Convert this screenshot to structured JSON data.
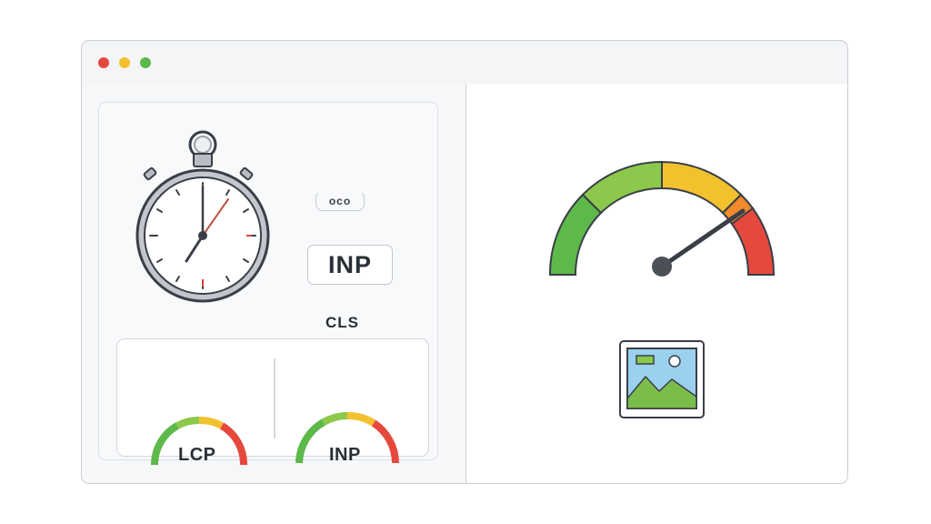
{
  "window": {
    "controls": [
      "close",
      "minimize",
      "maximize"
    ]
  },
  "left_panel": {
    "stopwatch_icon": "stopwatch-icon",
    "small_pill_text": "oco",
    "inp_badge_text": "INP",
    "cls_text": "CLS",
    "mini_gauges": [
      {
        "label": "LCP"
      },
      {
        "label": "INP"
      }
    ]
  },
  "right_panel": {
    "gauge_icon": "speedometer-gauge-icon",
    "image_icon": "image-placeholder-icon"
  },
  "colors": {
    "green": "#5cb94a",
    "light_green": "#8cc84b",
    "yellow": "#f2c12e",
    "orange": "#f08a2b",
    "red": "#e5493d",
    "outline": "#3a3f47"
  }
}
